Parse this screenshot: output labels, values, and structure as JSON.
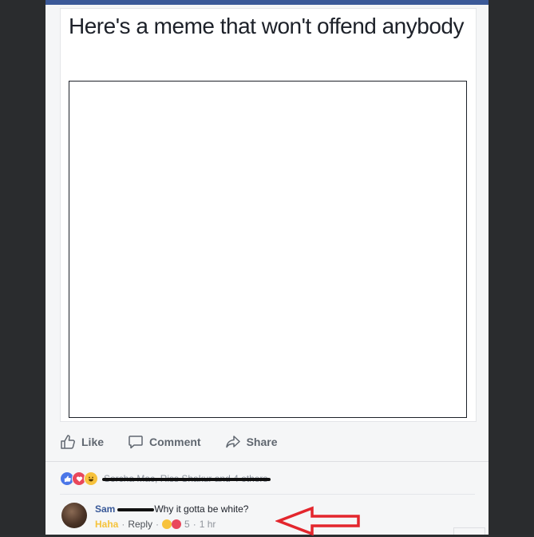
{
  "post": {
    "meme_text": "Here's a meme that won't offend anybody"
  },
  "actions": {
    "like_label": "Like",
    "comment_label": "Comment",
    "share_label": "Share"
  },
  "reactions": {
    "names_text": "Sorcha Mac, Riss Shakur and 4 others",
    "icons": [
      "like-icon",
      "love-icon",
      "haha-icon"
    ]
  },
  "comment": {
    "author_first": "Sam",
    "text": "Why it gotta be white?",
    "reaction_label": "Haha",
    "reply_label": "Reply",
    "dot1": "·",
    "dot2": "·",
    "reaction_count": "5",
    "time": "1 hr"
  },
  "colors": {
    "brand": "#3b5998",
    "link": "#385898",
    "haha": "#f5c33b",
    "arrow": "#e3262d"
  }
}
